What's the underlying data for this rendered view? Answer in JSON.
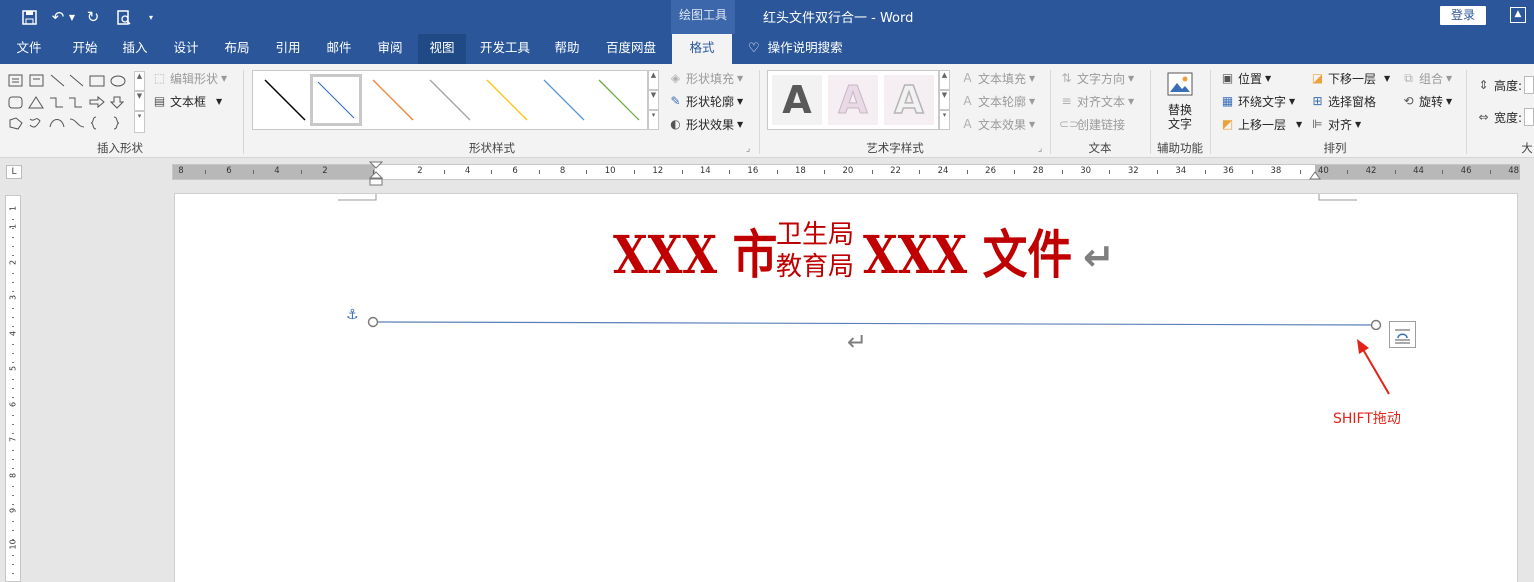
{
  "window": {
    "context_tab_group": "绘图工具",
    "doc_title": "红头文件双行合一  -  Word",
    "login": "登录"
  },
  "tabs": [
    {
      "label": "文件"
    },
    {
      "label": "开始"
    },
    {
      "label": "插入"
    },
    {
      "label": "设计"
    },
    {
      "label": "布局"
    },
    {
      "label": "引用"
    },
    {
      "label": "邮件"
    },
    {
      "label": "审阅"
    },
    {
      "label": "视图"
    },
    {
      "label": "开发工具"
    },
    {
      "label": "帮助"
    },
    {
      "label": "百度网盘"
    },
    {
      "label": "格式"
    }
  ],
  "tell_me": "操作说明搜索",
  "ribbon": {
    "insert_shapes": {
      "label": "插入形状",
      "edit_shape": "编辑形状",
      "text_box": "文本框"
    },
    "shape_styles": {
      "label": "形状样式",
      "fill": "形状填充",
      "outline": "形状轮廓",
      "effects": "形状效果",
      "swatch_colors": [
        "#000000",
        "#4472c4",
        "#ed7d31",
        "#a5a5a5",
        "#ffc000",
        "#5b9bd5",
        "#70ad47"
      ]
    },
    "wordart": {
      "label": "艺术字样式",
      "sample": "A",
      "text_fill": "文本填充",
      "text_outline": "文本轮廓",
      "text_effects": "文本效果"
    },
    "text": {
      "label": "文本",
      "direction": "文字方向",
      "align": "对齐文本",
      "link": "创建链接"
    },
    "accessibility": {
      "label": "辅助功能",
      "alt_text_line1": "替换",
      "alt_text_line2": "文字"
    },
    "arrange": {
      "label": "排列",
      "position": "位置",
      "wrap": "环绕文字",
      "bring_forward": "上移一层",
      "send_backward": "下移一层",
      "selection_pane": "选择窗格",
      "align": "对齐",
      "group": "组合",
      "rotate": "旋转"
    },
    "size": {
      "label": "大",
      "height": "高度:",
      "width": "宽度:"
    }
  },
  "hruler_numbers": [
    "8",
    "6",
    "4",
    "2",
    "2",
    "4",
    "6",
    "8",
    "10",
    "12",
    "14",
    "16",
    "18",
    "20",
    "22",
    "24",
    "26",
    "28",
    "30",
    "32",
    "34",
    "36",
    "38",
    "40",
    "42",
    "44",
    "46",
    "48"
  ],
  "vruler_numbers": [
    "1",
    "1",
    "2",
    "3",
    "4",
    "5",
    "6",
    "7",
    "8",
    "9",
    "10"
  ],
  "document": {
    "heading_left": "XXX 市",
    "heading_top": "卫生局",
    "heading_bottom": "教育局",
    "heading_right": "XXX 文件",
    "para_mark": "↵"
  },
  "annotation": "SHIFT拖动",
  "colors": {
    "brand": "#2b579a",
    "heading_red": "#c00000",
    "line_blue": "#5b7fb8",
    "annotation_red": "#e2231a"
  }
}
